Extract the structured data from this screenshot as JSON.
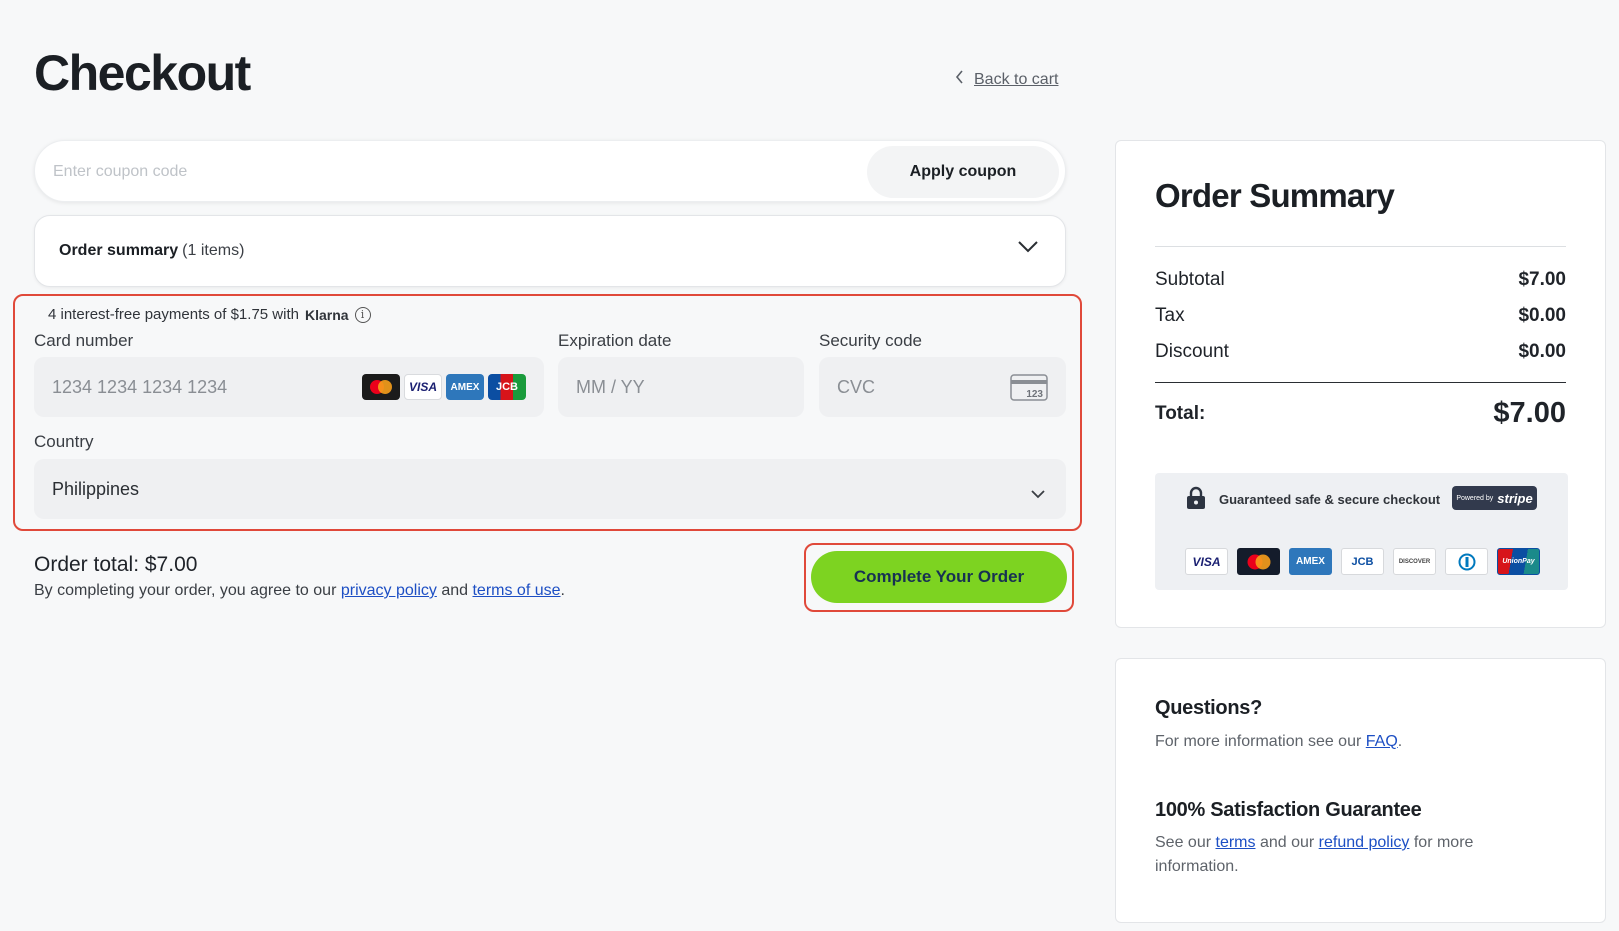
{
  "page": {
    "title": "Checkout",
    "back_link": "Back to cart"
  },
  "coupon": {
    "placeholder": "Enter coupon code",
    "value": "",
    "apply_label": "Apply coupon"
  },
  "order_summary_toggle": {
    "label": "Order summary",
    "count": "(1 items)"
  },
  "payment": {
    "klarna_text": "4 interest-free payments of $1.75 with",
    "klarna_brand": "Klarna",
    "card_number": {
      "label": "Card number",
      "placeholder": "1234 1234 1234 1234",
      "brands": [
        "mastercard",
        "VISA",
        "AMEX",
        "JCB"
      ]
    },
    "expiration": {
      "label": "Expiration date",
      "placeholder": "MM / YY"
    },
    "security": {
      "label": "Security code",
      "placeholder": "CVC",
      "icon_text": "123"
    },
    "country": {
      "label": "Country",
      "value": "Philippines"
    }
  },
  "footer": {
    "order_total": "Order total: $7.00",
    "agree_prefix": "By completing your order, you agree to our",
    "privacy_link": "privacy policy",
    "and": "and",
    "terms_link": "terms of use",
    "period": ".",
    "complete_label": "Complete Your Order"
  },
  "summary": {
    "title": "Order Summary",
    "rows": [
      {
        "label": "Subtotal",
        "value": "$7.00"
      },
      {
        "label": "Tax",
        "value": "$0.00"
      },
      {
        "label": "Discount",
        "value": "$0.00"
      }
    ],
    "total_label": "Total:",
    "total_value": "$7.00",
    "secure_text": "Guaranteed safe & secure checkout",
    "powered_by": "Powered by",
    "stripe": "stripe",
    "payment_icons": [
      "VISA",
      "MC",
      "AMEX",
      "JCB",
      "DISCOVER",
      "DINERS",
      "UnionPay"
    ]
  },
  "questions": {
    "title": "Questions?",
    "text_prefix": "For more information see our",
    "faq_link": "FAQ",
    "text_suffix": ".",
    "guarantee_title": "100% Satisfaction Guarantee",
    "g_prefix": "See our",
    "g_terms": "terms",
    "g_mid": "and our",
    "g_refund": "refund policy",
    "g_suffix": "for more information."
  },
  "colors": {
    "accent_green": "#7dd321",
    "highlight_red": "#e0493a",
    "link_blue": "#1d4fc4"
  }
}
